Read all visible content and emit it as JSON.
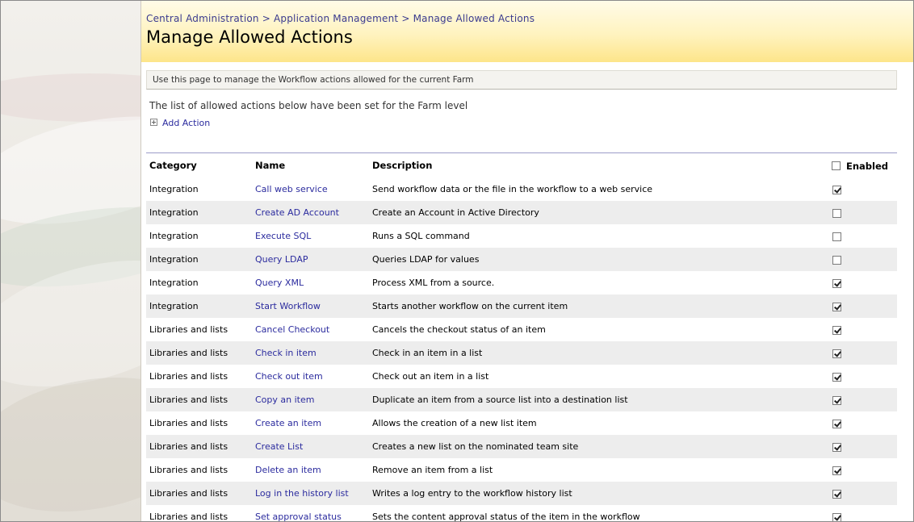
{
  "breadcrumb": "Central Administration > Application Management > Manage Allowed Actions",
  "page_title": "Manage Allowed Actions",
  "page_description": "Use this page to manage the Workflow actions allowed for the current Farm",
  "farm_note": "The list of allowed actions below have been set for the Farm level",
  "add_action_label": "Add Action",
  "columns": {
    "category": "Category",
    "name": "Name",
    "description": "Description",
    "enabled": "Enabled"
  },
  "colors": {
    "link": "#2b2b9e",
    "header_gradient_end": "#fde58a",
    "alt_row": "#ededed"
  },
  "rows": [
    {
      "category": "Integration",
      "name": "Call web service",
      "description": "Send workflow data or the file in the workflow to a web service",
      "enabled": true
    },
    {
      "category": "Integration",
      "name": "Create AD Account",
      "description": "Create an Account in Active Directory",
      "enabled": false
    },
    {
      "category": "Integration",
      "name": "Execute SQL",
      "description": "Runs a SQL command",
      "enabled": false
    },
    {
      "category": "Integration",
      "name": "Query LDAP",
      "description": "Queries LDAP for values",
      "enabled": false
    },
    {
      "category": "Integration",
      "name": "Query XML",
      "description": "Process XML from a source.",
      "enabled": true
    },
    {
      "category": "Integration",
      "name": "Start Workflow",
      "description": "Starts another workflow on the current item",
      "enabled": true
    },
    {
      "category": "Libraries and lists",
      "name": "Cancel Checkout",
      "description": "Cancels the checkout status of an item",
      "enabled": true
    },
    {
      "category": "Libraries and lists",
      "name": "Check in item",
      "description": "Check in an item in a list",
      "enabled": true
    },
    {
      "category": "Libraries and lists",
      "name": "Check out item",
      "description": "Check out an item in a list",
      "enabled": true
    },
    {
      "category": "Libraries and lists",
      "name": "Copy an item",
      "description": "Duplicate an item from a source list into a destination list",
      "enabled": true
    },
    {
      "category": "Libraries and lists",
      "name": "Create an item",
      "description": "Allows the creation of a new list item",
      "enabled": true
    },
    {
      "category": "Libraries and lists",
      "name": "Create List",
      "description": "Creates a new list on the nominated team site",
      "enabled": true
    },
    {
      "category": "Libraries and lists",
      "name": "Delete an item",
      "description": "Remove an item from a list",
      "enabled": true
    },
    {
      "category": "Libraries and lists",
      "name": "Log in the history list",
      "description": "Writes a log entry to the workflow history list",
      "enabled": true
    },
    {
      "category": "Libraries and lists",
      "name": "Set approval status",
      "description": "Sets the content approval status of the item in the workflow",
      "enabled": true
    }
  ]
}
